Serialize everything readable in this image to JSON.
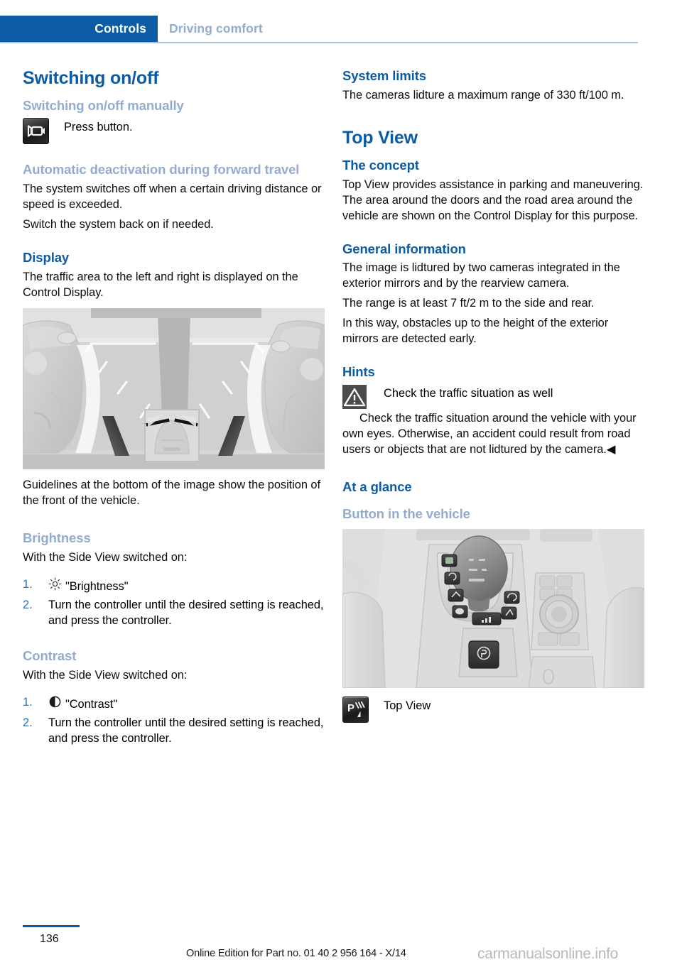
{
  "header": {
    "chapter_tab": "Controls",
    "section": "Driving comfort"
  },
  "left_column": {
    "h1_switching": "Switching on/off",
    "h3_manually": "Switching on/off manually",
    "press_button_text": "Press button.",
    "press_button_icon": "side-view-camera-button-icon",
    "h3_auto_deactivation": "Automatic deactivation during forward travel",
    "p_auto_1": "The system switches off when a certain driving distance or speed is exceeded.",
    "p_auto_2": "Switch the system back on if needed.",
    "h2_display": "Display",
    "p_display": "The traffic area to the left and right is displayed on the Control Display.",
    "figure_sideview_alt": "Side View display showing traffic to the left and right with guidelines",
    "p_guidelines": "Guidelines at the bottom of the image show the position of the front of the vehicle.",
    "h3_brightness": "Brightness",
    "p_brightness_intro": "With the Side View switched on:",
    "brightness_steps": [
      {
        "num": "1.",
        "icon": "sun-brightness-icon",
        "text": "\"Brightness\""
      },
      {
        "num": "2.",
        "icon": "",
        "text": "Turn the controller until the desired setting is reached, and press the controller."
      }
    ],
    "h3_contrast": "Contrast",
    "p_contrast_intro": "With the Side View switched on:",
    "contrast_steps": [
      {
        "num": "1.",
        "icon": "half-circle-contrast-icon",
        "text": "\"Contrast\""
      },
      {
        "num": "2.",
        "icon": "",
        "text": "Turn the controller until the desired setting is reached, and press the controller."
      }
    ]
  },
  "right_column": {
    "h2_system_limits": "System limits",
    "p_system_limits": "The cameras lidture a maximum range of 330 ft/100 m.",
    "h1_top_view": "Top View",
    "h2_the_concept": "The concept",
    "p_concept": "Top View provides assistance in parking and maneuvering. The area around the doors and the road area around the vehicle are shown on the Control Display for this purpose.",
    "h2_general_information": "General information",
    "p_general_1": "The image is lidtured by two cameras integrated in the exterior mirrors and by the rearview camera.",
    "p_general_2": "The range is at least 7 ft/2 m to the side and rear.",
    "p_general_3": "In this way, obstacles up to the height of the exterior mirrors are detected early.",
    "h2_hints": "Hints",
    "warning_icon": "warning-triangle-icon",
    "warning_title": "Check the traffic situation as well",
    "warning_body": "Check the traffic situation around the vehicle with your own eyes. Otherwise, an accident could result from road users or objects that are not lidtured by the camera.◀",
    "h2_at_a_glance": "At a glance",
    "h3_button_in_vehicle": "Button in the vehicle",
    "figure_console_alt": "Center console with gear selector, function buttons and iDrive controller",
    "top_view_button_icon": "top-view-parking-button-icon",
    "top_view_label": "Top View"
  },
  "footer": {
    "page_number": "136",
    "edition": "Online Edition for Part no. 01 40 2 956 164 - X/14",
    "watermark": "carmanualsonline.info"
  },
  "colors": {
    "tab_blue": "#0b5ca4",
    "heading_blue": "#0b5ca4",
    "subheading_pale_blue": "#93acce",
    "rule_blue": "#a9c2de",
    "list_number_blue": "#2a6db5",
    "figure_bg": "#e3e3e3",
    "warning_box": "#4b4b4b"
  }
}
